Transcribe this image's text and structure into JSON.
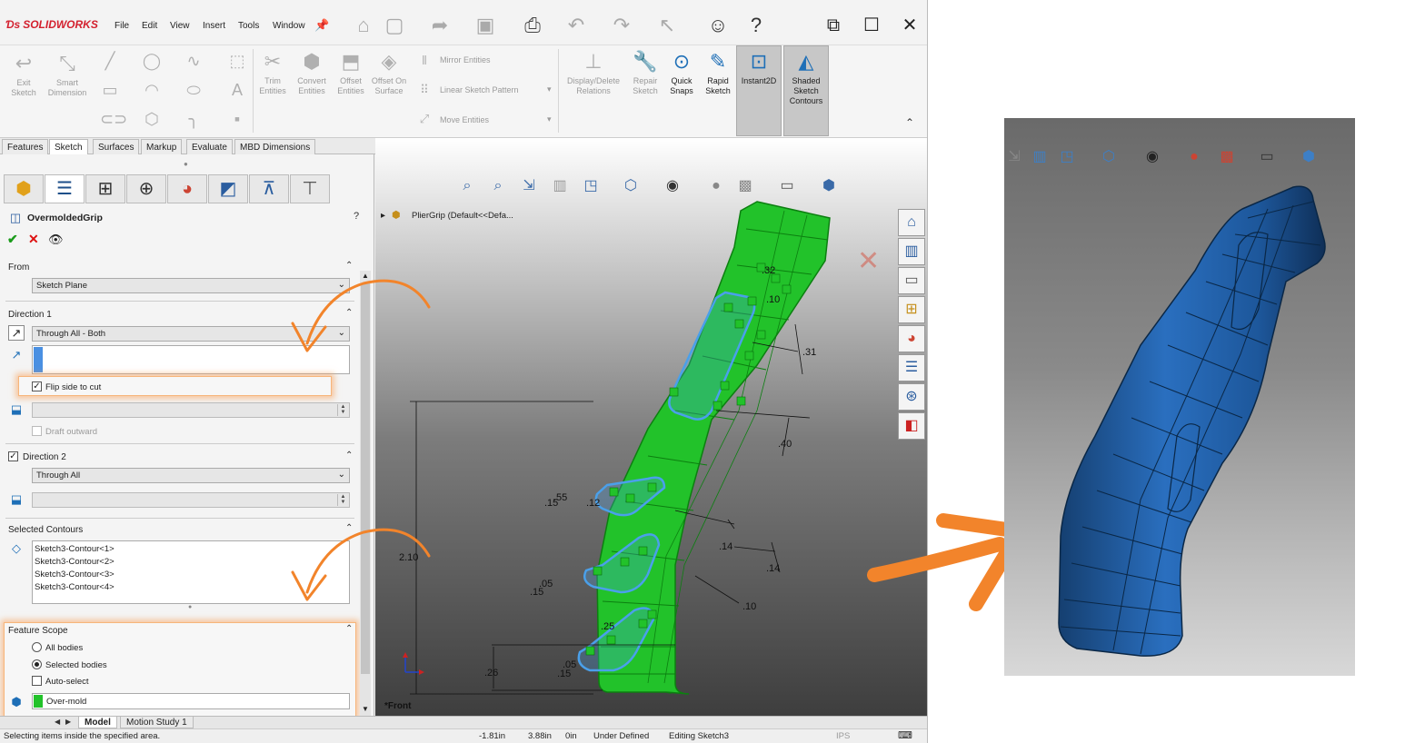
{
  "app": {
    "name": "SOLIDWORKS",
    "menu": [
      "File",
      "Edit",
      "View",
      "Insert",
      "Tools",
      "Window"
    ]
  },
  "ribbon": {
    "buttons": [
      {
        "label": "Exit Sketch",
        "icon": "exit-sketch-icon"
      },
      {
        "label": "Smart Dimension",
        "icon": "smart-dimension-icon"
      },
      {
        "label": "Trim Entities",
        "icon": "trim-icon"
      },
      {
        "label": "Convert Entities",
        "icon": "convert-icon"
      },
      {
        "label": "Offset Entities",
        "icon": "offset-icon"
      },
      {
        "label": "Offset On Surface",
        "icon": "offset-surface-icon"
      },
      {
        "label": "Display/Delete Relations",
        "icon": "relations-icon"
      },
      {
        "label": "Repair Sketch",
        "icon": "repair-icon"
      },
      {
        "label": "Quick Snaps",
        "icon": "quick-snaps-icon"
      },
      {
        "label": "Rapid Sketch",
        "icon": "rapid-sketch-icon"
      },
      {
        "label": "Instant2D",
        "icon": "instant2d-icon"
      },
      {
        "label": "Shaded Sketch Contours",
        "icon": "shaded-contours-icon"
      }
    ],
    "small": {
      "mirror": "Mirror Entities",
      "linear": "Linear Sketch Pattern",
      "move": "Move Entities"
    }
  },
  "tabs": [
    "Features",
    "Sketch",
    "Surfaces",
    "Markup",
    "Evaluate",
    "MBD Dimensions"
  ],
  "feature": {
    "title": "OvermoldedGrip",
    "from": {
      "title": "From",
      "value": "Sketch Plane"
    },
    "direction1": {
      "title": "Direction 1",
      "end": "Through All - Both",
      "flip": "Flip side to cut",
      "draft": "Draft outward"
    },
    "direction2": {
      "title": "Direction 2",
      "end": "Through All"
    },
    "contours": {
      "title": "Selected Contours",
      "items": [
        "Sketch3-Contour<1>",
        "Sketch3-Contour<2>",
        "Sketch3-Contour<3>",
        "Sketch3-Contour<4>"
      ]
    },
    "scope": {
      "title": "Feature Scope",
      "all": "All bodies",
      "selected": "Selected bodies",
      "auto": "Auto-select",
      "body": "Over-mold"
    }
  },
  "viewport": {
    "tree": "PlierGrip  (Default<<Defa...",
    "view_label": "*Front",
    "dims": [
      ".15",
      ".55",
      ".12",
      ".05",
      ".15",
      ".25",
      ".05",
      ".15",
      ".26",
      "2.10",
      ".14",
      ".14",
      ".10",
      ".31",
      ".40",
      ".32",
      ".10"
    ]
  },
  "bottom_tabs": [
    "Model",
    "Motion Study 1"
  ],
  "status": {
    "message": "Selecting items inside the specified area.",
    "x": "-1.81in",
    "y": "3.88in",
    "z": "0in",
    "state": "Under Defined",
    "editing": "Editing Sketch3",
    "units": "IPS"
  },
  "colors": {
    "accent": "#1e6fb7",
    "sketch_green": "#22c22a",
    "contour_blue": "#4aa0ea",
    "body_blue": "#1f5fa5",
    "arrow_orange": "#f2842b"
  }
}
